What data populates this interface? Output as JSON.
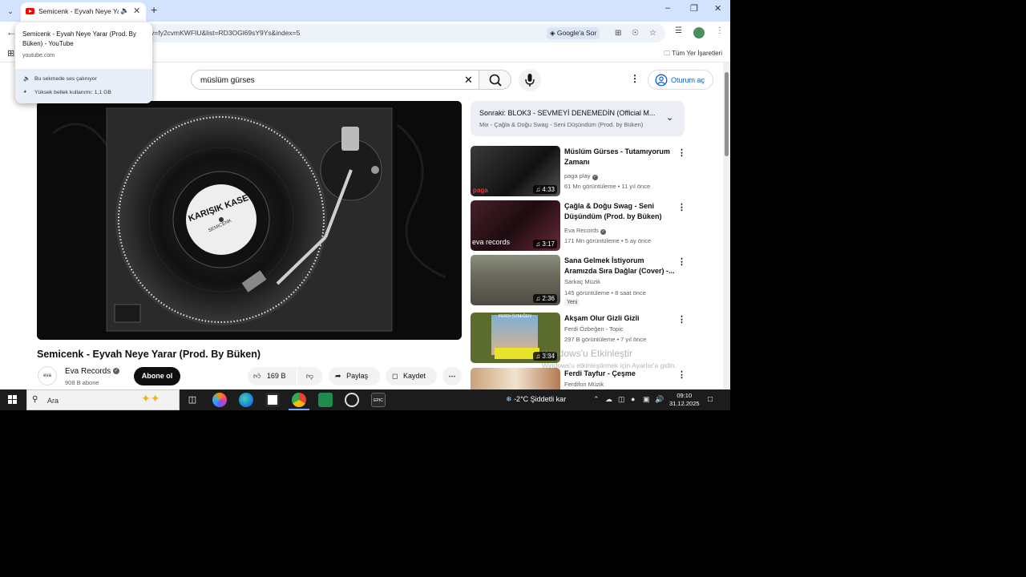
{
  "browser": {
    "tab": {
      "title": "Semicenk - Eyvah Neye Yarar (Prod. By Büken) - YouTube",
      "short_title": "Semicenk - Eyvah Neye Yara"
    },
    "new_tab": "+",
    "url": "v=fy2cvmKWFIU&list=RD3OGl69sY9Ys&index=5",
    "ask_google": "Google'a Sor",
    "all_bookmarks": "Tüm Yer İşaretleri"
  },
  "hovercard": {
    "title": "Semicenk - Eyvah Neye Yarar (Prod. By Büken) - YouTube",
    "domain": "youtube.com",
    "audio_status": "Bu sekmede ses çalınıyor",
    "memory_status": "Yüksek bellek kullanımı: 1,1 GB"
  },
  "youtube": {
    "search_query": "müslüm gürses",
    "signin_label": "Oturum aç",
    "player": {
      "record_label_line1": "KARIŞIK KASET",
      "record_label_line2": "SEMICENK"
    },
    "video": {
      "title": "Semicenk - Eyvah Neye Yarar (Prod. By Büken)",
      "channel": "Eva Records",
      "avatar_text": "eva",
      "subscribers": "908 B abone",
      "subscribe_label": "Abone ol",
      "likes": "169 B",
      "share_label": "Paylaş",
      "save_label": "Kaydet"
    },
    "up_next": {
      "title": "Sonraki: BLOK3 - SEVMEYİ DENEMEDİN (Official M...",
      "subtitle": "Mix - Çağla & Doğu Swag - Seni Düşündüm (Prod. by Büken)"
    },
    "recommendations": [
      {
        "title": "Müslüm Gürses - Tutamıyorum Zamanı",
        "channel": "paga play",
        "meta": "61 Mn görüntüleme • 11 yıl önce",
        "duration": "4:33",
        "thumb_text": "paga",
        "badge": ""
      },
      {
        "title": "Çağla & Doğu Swag - Seni Düşündüm (Prod. by Büken)",
        "channel": "Eva Records",
        "meta": "171 Mn görüntüleme • 5 ay önce",
        "duration": "3:17",
        "thumb_text": "eva records",
        "badge": ""
      },
      {
        "title": "Sana Gelmek İstiyorum Aramızda Sıra Dağlar (Cover) -...",
        "channel": "Sarkaç Müzik",
        "meta": "145 görüntüleme • 8 saat önce",
        "duration": "2:36",
        "thumb_text": "",
        "badge": "Yeni"
      },
      {
        "title": "Akşam Olur Gizli Gizli",
        "channel": "Ferdi Özbeğen - Topic",
        "meta": "297 B görüntüleme • 7 yıl önce",
        "duration": "3:34",
        "thumb_text": "FERDİ ÖZBEĞEN",
        "badge": ""
      },
      {
        "title": "Ferdi Tayfur - Çeşme",
        "channel": "Ferdifon Müzik",
        "meta": "",
        "duration": "",
        "thumb_text": "",
        "badge": ""
      }
    ],
    "watermark": {
      "line1": "Windows'u Etkinleştir",
      "line2": "Windows'u etkinleştirmek için Ayarlar'a gidin."
    }
  },
  "taskbar": {
    "search_text": "Ara",
    "weather": "-2°C  Şiddetli kar",
    "time": "09:10",
    "date": "31.12.2025"
  },
  "colors": {
    "youtube_red": "#ff0000",
    "link_blue": "#065fd4",
    "tabstrip": "#d3e3fd",
    "taskbar": "#1c1c1c"
  }
}
